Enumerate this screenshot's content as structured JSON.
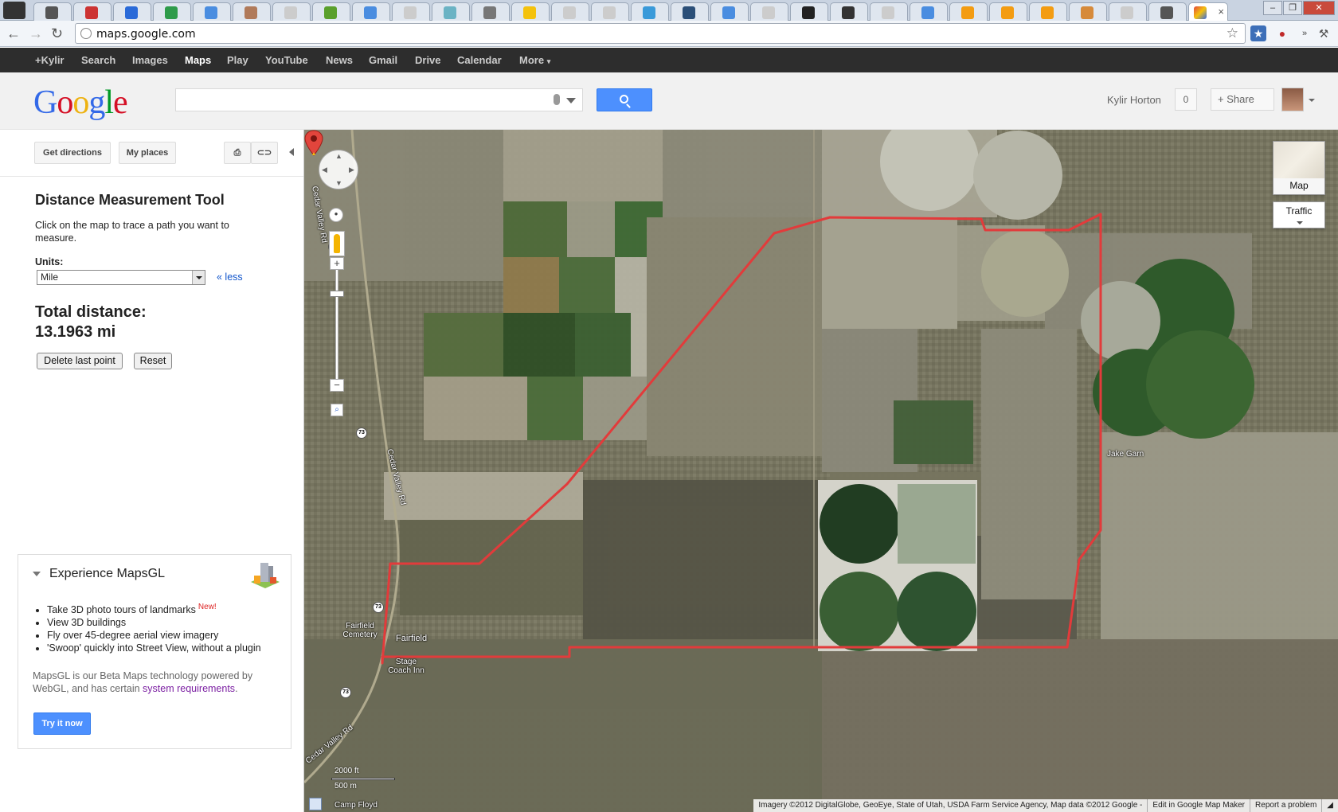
{
  "browser": {
    "url": "maps.google.com",
    "active_tab_close": "×",
    "extensions": [
      "bookmark-star-icon",
      "car-icon",
      "overflow-icon",
      "wrench-icon"
    ]
  },
  "gbar": {
    "items": [
      "+Kylir",
      "Search",
      "Images",
      "Maps",
      "Play",
      "YouTube",
      "News",
      "Gmail",
      "Drive",
      "Calendar",
      "More"
    ],
    "active": "Maps",
    "more_caret": "▾"
  },
  "header": {
    "logo": "Google",
    "search_value": "",
    "user_name": "Kylir Horton",
    "notification_count": "0",
    "share_label": "+ Share"
  },
  "panel": {
    "get_directions": "Get directions",
    "my_places": "My places",
    "tool": {
      "title": "Distance Measurement Tool",
      "instructions": "Click on the map to trace a path you want to measure.",
      "units_label": "Units:",
      "units_value": "Mile",
      "less_link": "« less",
      "total_label": "Total distance:",
      "total_value": "13.1963 mi",
      "delete_last_point": "Delete last point",
      "reset": "Reset"
    },
    "mapsgl": {
      "title": "Experience MapsGL",
      "features": [
        "Take 3D photo tours of landmarks",
        "View 3D buildings",
        "Fly over 45-degree aerial view imagery",
        "'Swoop' quickly into Street View, without a plugin"
      ],
      "new_badge": "New!",
      "desc_prefix": "MapsGL is our Beta Maps technology powered by WebGL, and has certain ",
      "desc_link": "system requirements",
      "desc_suffix": ".",
      "try_button": "Try it now"
    }
  },
  "map": {
    "type_button": "Map",
    "traffic_button": "Traffic",
    "route_color": "#e23b3b",
    "labels": {
      "road_top": "Cedar Valley Rd",
      "road_mid": "Cedar Valley Rd",
      "road_bottom": "Cedar Valley Rd",
      "cemetery": "Fairfield Cemetery",
      "town": "Fairfield",
      "stagecoach": "Stage Coach Inn",
      "camp": "Camp Floyd",
      "jake": "Jake Garn"
    },
    "route_shield": "73",
    "scale_ft": "2000 ft",
    "scale_m": "500 m",
    "attribution": "Imagery ©2012 DigitalGlobe, GeoEye, State of Utah, USDA Farm Service Agency, Map data ©2012 Google -",
    "edit_link": "Edit in Google Map Maker",
    "report_link": "Report a problem"
  }
}
